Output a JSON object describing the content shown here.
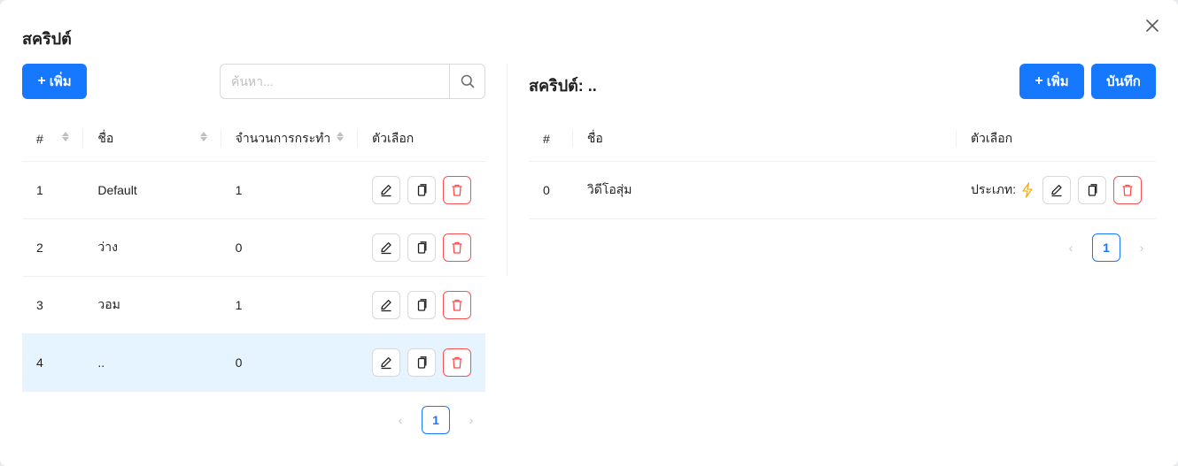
{
  "dialog": {
    "title": "สคริปต์"
  },
  "left": {
    "add_label": "เพิ่ม",
    "search": {
      "placeholder": "ค้นหา..."
    },
    "columns": {
      "index": "#",
      "name": "ชื่อ",
      "count": "จำนวนการกระทำ",
      "options": "ตัวเลือก"
    },
    "rows": [
      {
        "index": "1",
        "name": "Default",
        "count": "1"
      },
      {
        "index": "2",
        "name": "ว่าง",
        "count": "0"
      },
      {
        "index": "3",
        "name": "วอม",
        "count": "1"
      },
      {
        "index": "4",
        "name": "..",
        "count": "0"
      }
    ],
    "pagination": {
      "current": "1"
    }
  },
  "right": {
    "title": "สคริปต์: ..",
    "add_label": "เพิ่ม",
    "save_label": "บันทึก",
    "columns": {
      "index": "#",
      "name": "ชื่อ",
      "options": "ตัวเลือก"
    },
    "rows": [
      {
        "index": "0",
        "name": "วิดีโอสุ่ม",
        "type_label": "ประเภท:"
      }
    ],
    "pagination": {
      "current": "1"
    }
  },
  "colors": {
    "primary": "#1677ff",
    "danger": "#ff4d4f",
    "selected_row": "#e6f4ff",
    "bolt": "#faad14"
  },
  "icons": [
    "close-icon",
    "search-icon",
    "edit-icon",
    "copy-icon",
    "delete-icon",
    "bolt-icon",
    "chevron-left-icon",
    "chevron-right-icon"
  ]
}
